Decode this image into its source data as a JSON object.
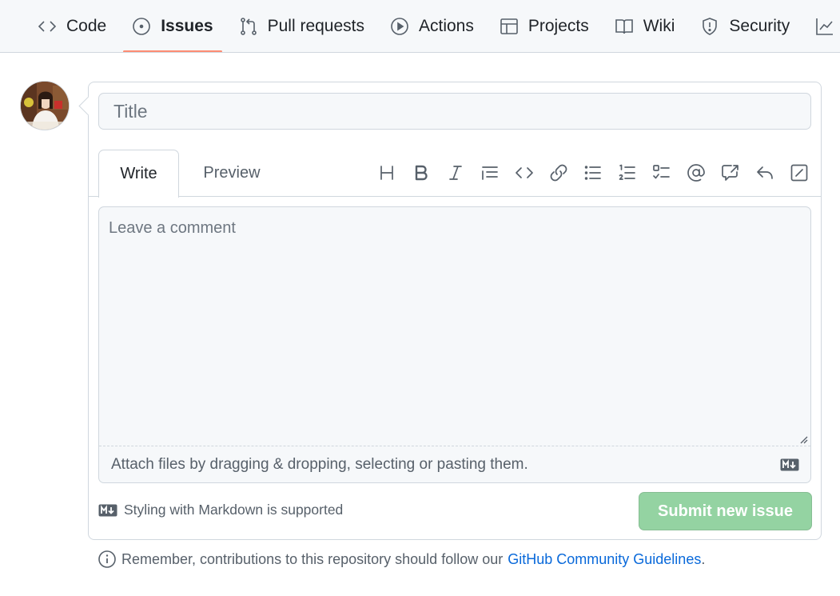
{
  "nav": {
    "items": [
      {
        "label": "Code",
        "icon": "code-icon"
      },
      {
        "label": "Issues",
        "icon": "issue-opened-icon",
        "selected": true
      },
      {
        "label": "Pull requests",
        "icon": "git-pull-request-icon"
      },
      {
        "label": "Actions",
        "icon": "play-icon"
      },
      {
        "label": "Projects",
        "icon": "table-icon"
      },
      {
        "label": "Wiki",
        "icon": "book-icon"
      },
      {
        "label": "Security",
        "icon": "shield-icon"
      }
    ],
    "accent_color": "#fd8c73"
  },
  "form": {
    "title_placeholder": "Title",
    "title_value": "",
    "tabs": {
      "write": "Write",
      "preview": "Preview"
    },
    "toolbar_icons": [
      "heading-icon",
      "bold-icon",
      "italic-icon",
      "quote-icon",
      "code-icon",
      "link-icon",
      "unordered-list-icon",
      "ordered-list-icon",
      "task-list-icon",
      "mention-icon",
      "cross-reference-icon",
      "saved-reply-icon",
      "slash-command-icon"
    ],
    "comment_placeholder": "Leave a comment",
    "attach_text": "Attach files by dragging & dropping, selecting or pasting them.",
    "markdown_note": "Styling with Markdown is supported",
    "submit_label": "Submit new issue",
    "submit_color": "#94d3a2"
  },
  "footer": {
    "text": "Remember, contributions to this repository should follow our",
    "link": "GitHub Community Guidelines",
    "period": "."
  }
}
